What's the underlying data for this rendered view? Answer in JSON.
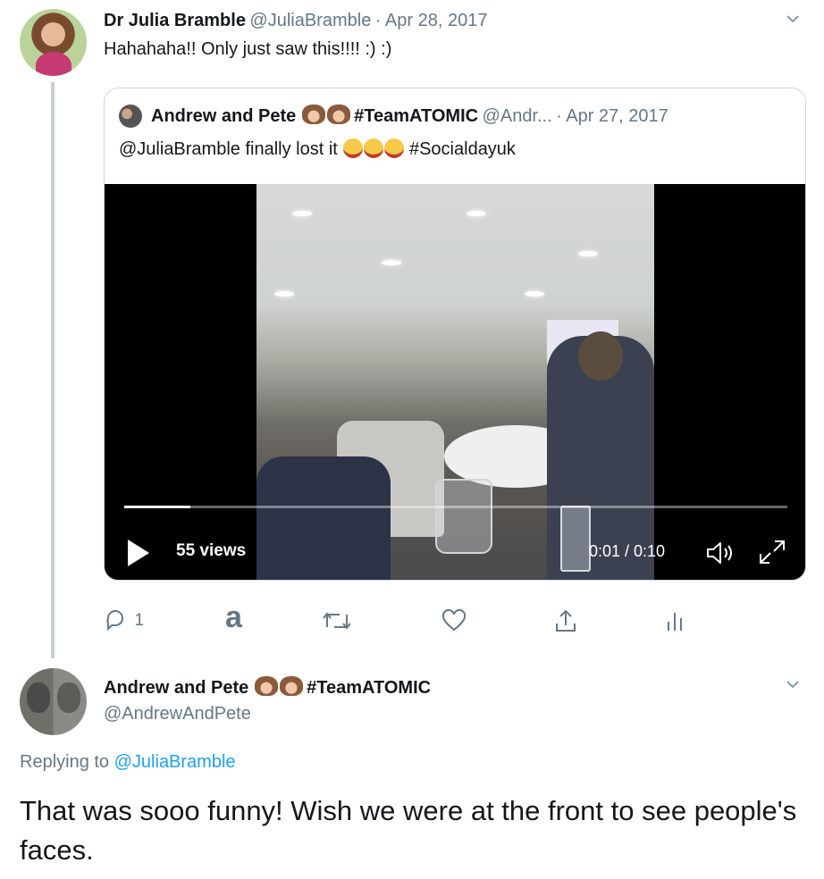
{
  "top_tweet": {
    "author_name": "Dr Julia Bramble",
    "handle": "@JuliaBramble",
    "separator": "·",
    "date": "Apr 28, 2017",
    "text": "Hahahaha!! Only just saw this!!!! :) :)"
  },
  "quoted_tweet": {
    "author_name": "Andrew and Pete",
    "hashtag_name": "#TeamATOMIC",
    "handle": "@Andr...",
    "separator": "·",
    "date": "Apr 27, 2017",
    "text_mention": "@JuliaBramble finally lost it",
    "text_hashtag": "#Socialdayuk",
    "video": {
      "views": "55 views",
      "time": "0:01 / 0:10",
      "progress_fraction": 0.1
    }
  },
  "action_bar": {
    "reply_count": "1",
    "amazon_glyph": "a",
    "icons": [
      "reply-icon",
      "amazon-icon",
      "retweet-icon",
      "like-icon",
      "share-icon",
      "analytics-icon"
    ]
  },
  "reply_tweet": {
    "author_name": "Andrew and Pete",
    "hashtag_name": "#TeamATOMIC",
    "handle": "@AndrewAndPete",
    "replying_prefix": "Replying to",
    "replying_to": "@JuliaBramble",
    "text": "That was sooo funny! Wish we were at the front to see people's faces."
  },
  "colors": {
    "link": "#1da1f2",
    "muted": "#657786",
    "border": "#ccd6dd"
  }
}
